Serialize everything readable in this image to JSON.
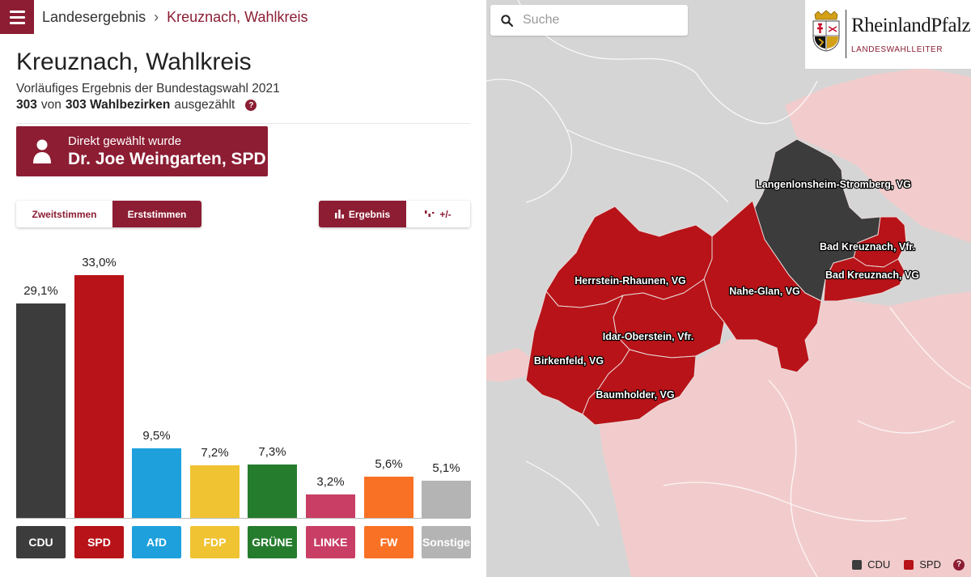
{
  "header": {
    "breadcrumb_root": "Landesergebnis",
    "breadcrumb_separator": "›",
    "breadcrumb_current": "Kreuznach, Wahlkreis"
  },
  "page": {
    "title": "Kreuznach, Wahlkreis",
    "subtitle": "Vorläufiges Ergebnis der Bundestagswahl 2021",
    "counted_done": "303",
    "counted_von": "von",
    "counted_total": "303 Wahlbezirken",
    "counted_suffix": "ausgezählt",
    "help_glyph": "?"
  },
  "elected": {
    "label": "Direkt gewählt wurde",
    "name": "Dr. Joe Weingarten, SPD",
    "icon": "person-icon"
  },
  "vote_toggle": {
    "zweitstimmen": "Zweitstimmen",
    "erststimmen": "Erststimmen",
    "active": "Erststimmen"
  },
  "view_toggle": {
    "ergebnis": "Ergebnis",
    "diff": "+/-",
    "active": "Ergebnis"
  },
  "chart_data": {
    "type": "bar",
    "categories": [
      "CDU",
      "SPD",
      "AfD",
      "FDP",
      "GRÜNE",
      "LINKE",
      "FW",
      "Sonstige"
    ],
    "values": [
      29.1,
      33.0,
      9.5,
      7.2,
      7.3,
      3.2,
      5.6,
      5.1
    ],
    "value_labels": [
      "29,1%",
      "33,0%",
      "9,5%",
      "7,2%",
      "7,3%",
      "3,2%",
      "5,6%",
      "5,1%"
    ],
    "colors": [
      "#3c3c3c",
      "#b81318",
      "#1ea0dc",
      "#f0c332",
      "#257c2d",
      "#c93e64",
      "#f97124",
      "#b4b4b4"
    ],
    "ylim": [
      0,
      33.0
    ]
  },
  "search": {
    "placeholder": "Suche"
  },
  "logo": {
    "name": "RheinlandPfalz",
    "subtitle": "LANDESWAHLLEITER"
  },
  "map": {
    "regions": [
      {
        "label": "Langenlonsheim-Stromberg, VG",
        "party": "CDU",
        "color": "#3c3c3c"
      },
      {
        "label": "Bad Kreuznach, Vfr.",
        "party": "SPD",
        "color": "#b81318"
      },
      {
        "label": "Bad Kreuznach, VG",
        "party": "SPD",
        "color": "#b81318"
      },
      {
        "label": "Herrstein-Rhaunen, VG",
        "party": "SPD",
        "color": "#b81318"
      },
      {
        "label": "Nahe-Glan, VG",
        "party": "SPD",
        "color": "#b81318"
      },
      {
        "label": "Idar-Oberstein, Vfr.",
        "party": "SPD",
        "color": "#b81318"
      },
      {
        "label": "Birkenfeld, VG",
        "party": "SPD",
        "color": "#b81318"
      },
      {
        "label": "Baumholder, VG",
        "party": "SPD",
        "color": "#b81318"
      }
    ],
    "legend": [
      {
        "label": "CDU",
        "color": "#3c3c3c"
      },
      {
        "label": "SPD",
        "color": "#b81318"
      }
    ]
  }
}
